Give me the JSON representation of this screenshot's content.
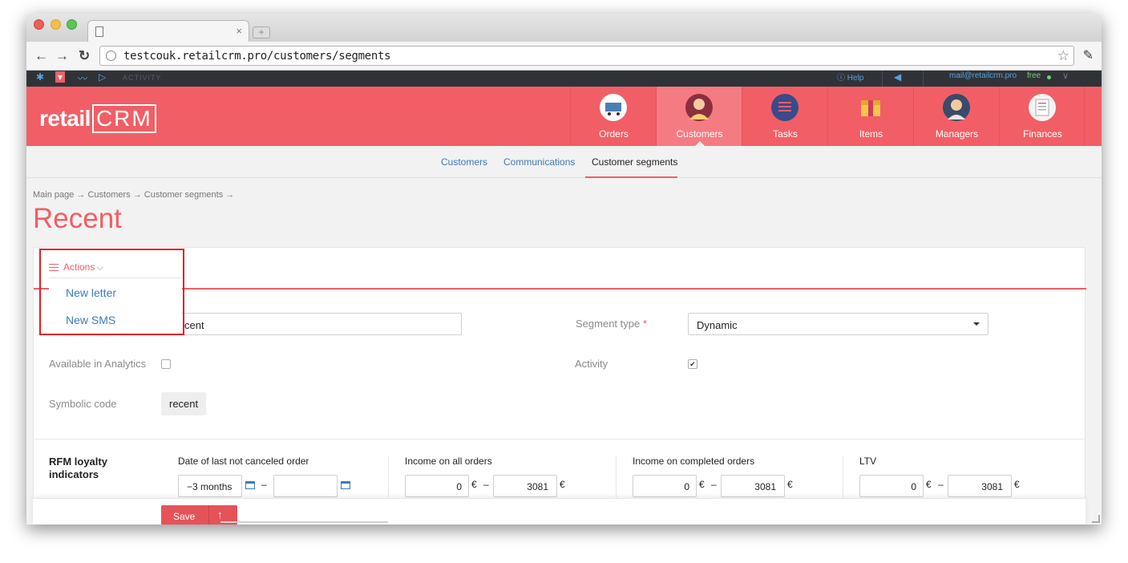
{
  "browser": {
    "url": "testcouk.retailcrm.pro/customers/segments",
    "tab_close": "×",
    "newtab": "+"
  },
  "topbar": {
    "activity": "ACTIVITY",
    "help": "Help",
    "email": "mail@retailcrm.pro",
    "plan": "free"
  },
  "header": {
    "logo_text": "retail",
    "logo_crm": "CRM",
    "nav": [
      {
        "label": "Orders",
        "color": "#3a4a6b"
      },
      {
        "label": "Customers",
        "color": "#f6d16b"
      },
      {
        "label": "Tasks",
        "color": "#3a4a8b"
      },
      {
        "label": "Items",
        "color": "#f5c64a"
      },
      {
        "label": "Managers",
        "color": "#3a4a6b"
      },
      {
        "label": "Finances",
        "color": "#f4f4f4"
      }
    ]
  },
  "subnav": {
    "items": [
      "Customers",
      "Communications",
      "Customer segments"
    ]
  },
  "breadcrumb": "Main page → Customers → Customer segments →",
  "page_title": "Recent",
  "actions": {
    "label": "Actions",
    "menu": [
      "New letter",
      "New SMS"
    ]
  },
  "form": {
    "name_value": "cent",
    "segment_type_label": "Segment type",
    "segment_type_required": "*",
    "segment_type_value": "Dynamic",
    "analytics_label": "Available in Analytics",
    "analytics_checked": false,
    "activity_label": "Activity",
    "activity_checked": true,
    "symbolic_code_label": "Symbolic code",
    "symbolic_code_value": "recent"
  },
  "rfm": {
    "title": "RFM loyalty indicators",
    "date_label": "Date of last not canceled order",
    "date_from": "−3 months",
    "date_to": "",
    "range_dash": "–",
    "currency": "€",
    "income_all_label": "Income on all orders",
    "income_all_from": "0",
    "income_all_to": "3081",
    "income_completed_label": "Income on completed orders",
    "income_completed_from": "0",
    "income_completed_to": "3081",
    "ltv_label": "LTV",
    "ltv_from": "0",
    "ltv_to": "3081"
  },
  "footer": {
    "save_label": "Save",
    "up_arrow": "↑"
  },
  "colors": {
    "brand_red": "#f15e66",
    "link_blue": "#3d7ab8",
    "highlight_red": "#e31b23"
  }
}
